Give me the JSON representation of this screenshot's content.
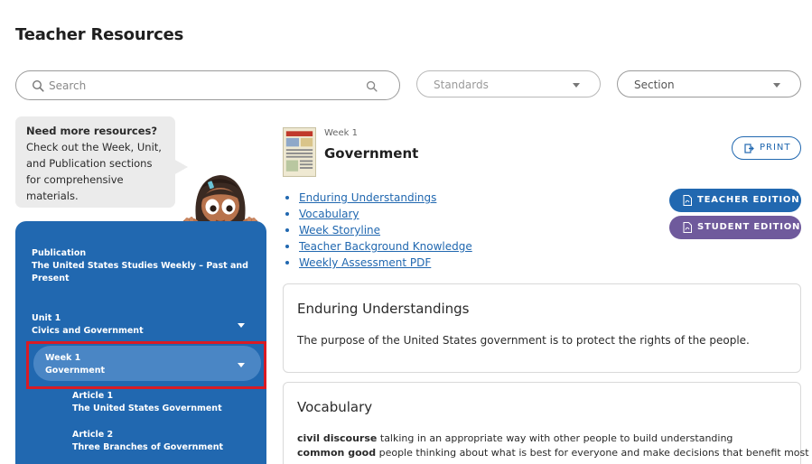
{
  "page": {
    "title": "Teacher Resources"
  },
  "search": {
    "placeholder": "Search"
  },
  "filters": {
    "standards": {
      "label": "Standards"
    },
    "section": {
      "label": "Section"
    }
  },
  "help_bubble": {
    "heading": "Need more resources?",
    "body": "Check out the Week, Unit, and Publication sections for comprehensive materials."
  },
  "sidebar": {
    "publication": {
      "kicker": "Publication",
      "name": "The United States Studies Weekly – Past and Present"
    },
    "unit": {
      "kicker": "Unit 1",
      "name": "Civics and Government"
    },
    "week": {
      "kicker": "Week 1",
      "name": "Government"
    },
    "articles": [
      {
        "kicker": "Article 1",
        "name": "The United States Government"
      },
      {
        "kicker": "Article 2",
        "name": "Three Branches of Government"
      }
    ]
  },
  "content": {
    "eyebrow": "Week 1",
    "title": "Government",
    "print_label": "PRINT",
    "teacher_edition_label": "TEACHER EDITION",
    "student_edition_label": "STUDENT EDITION",
    "links": [
      "Enduring Understandings",
      "Vocabulary",
      "Week Storyline",
      "Teacher Background Knowledge",
      "Weekly Assessment PDF"
    ]
  },
  "cards": {
    "enduring": {
      "title": "Enduring Understandings",
      "body": "The purpose of the United States government is to protect the rights of the people."
    },
    "vocabulary": {
      "title": "Vocabulary",
      "terms": [
        {
          "term": "civil discourse",
          "definition": "talking in an appropriate way with other people to build understanding"
        },
        {
          "term": "common good",
          "definition": "people thinking about what is best for everyone and make decisions that benefit most"
        }
      ]
    }
  },
  "colors": {
    "brand_blue": "#2168b0",
    "selected_item": "#4a86c5",
    "student_purple": "#6f5a9c",
    "highlight_red": "#d91b24"
  },
  "icons": [
    "search-icon",
    "magnifier-icon",
    "chevron-down-icon",
    "print-icon",
    "pdf-icon"
  ]
}
